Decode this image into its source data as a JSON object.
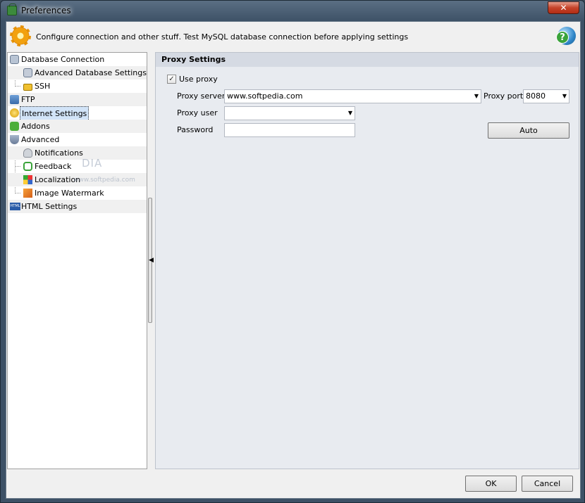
{
  "window": {
    "title": "Preferences",
    "close_glyph": "✕"
  },
  "header": {
    "description": "Configure connection and other stuff. Test MySQL database connection before applying settings",
    "help_glyph": "?"
  },
  "tree": {
    "items": [
      {
        "label": "Database Connection",
        "icon": "database-icon",
        "level": 0
      },
      {
        "label": "Advanced Database Settings",
        "icon": "database-settings-icon",
        "level": 1
      },
      {
        "label": "SSH",
        "icon": "lock-icon",
        "level": 1
      },
      {
        "label": "FTP",
        "icon": "network-icon",
        "level": 0
      },
      {
        "label": "Internet Settings",
        "icon": "internet-icon",
        "level": 0,
        "selected": true
      },
      {
        "label": "Addons",
        "icon": "puzzle-icon",
        "level": 0
      },
      {
        "label": "Advanced",
        "icon": "shield-icon",
        "level": 0
      },
      {
        "label": "Notifications",
        "icon": "notification-icon",
        "level": 1
      },
      {
        "label": "Feedback",
        "icon": "feedback-icon",
        "level": 1
      },
      {
        "label": "Localization",
        "icon": "localization-icon",
        "level": 1
      },
      {
        "label": "Image Watermark",
        "icon": "image-icon",
        "level": 1
      },
      {
        "label": "HTML Settings",
        "icon": "html-icon",
        "level": 0
      }
    ]
  },
  "watermark": {
    "text": "DIA",
    "subtext": "www.softpedia.com"
  },
  "proxy": {
    "section_title": "Proxy Settings",
    "use_proxy_label": "Use proxy",
    "use_proxy_checked": true,
    "check_glyph": "✓",
    "server_label": "Proxy server",
    "server_value": "www.softpedia.com",
    "port_label": "Proxy port",
    "port_value": "8080",
    "user_label": "Proxy user",
    "user_value": "",
    "password_label": "Password",
    "password_value": "",
    "auto_label": "Auto",
    "dropdown_glyph": "▼"
  },
  "footer": {
    "ok_label": "OK",
    "cancel_label": "Cancel"
  },
  "colors": {
    "selected_bg": "#d2e4f8",
    "panel_bg": "#e8ebf0",
    "section_bg": "#d5dae3"
  }
}
